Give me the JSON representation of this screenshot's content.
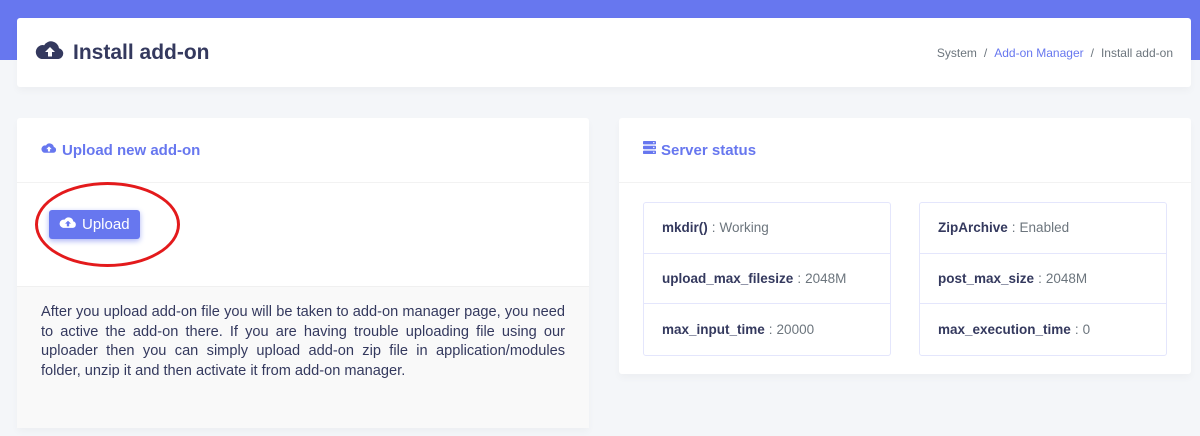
{
  "header": {
    "title": "Install add-on",
    "title_icon": "cloud-upload-icon"
  },
  "breadcrumb": {
    "items": [
      "System",
      "Add-on Manager",
      "Install add-on"
    ],
    "separator": "/"
  },
  "upload_card": {
    "title": "Upload new add-on",
    "title_icon": "cloud-upload-icon",
    "button_label": "Upload",
    "note": "After you upload add-on file you will be taken to add-on manager page, you need to active the add-on there. If you are having trouble uploading file using our uploader then you can simply upload add-on zip file in application/modules folder, unzip it and then activate it from add-on manager."
  },
  "server_card": {
    "title": "Server status",
    "title_icon": "server-icon",
    "left": [
      {
        "key": "mkdir()",
        "value": "Working"
      },
      {
        "key": "upload_max_filesize",
        "value": "2048M"
      },
      {
        "key": "max_input_time",
        "value": "20000"
      }
    ],
    "right": [
      {
        "key": "ZipArchive",
        "value": "Enabled"
      },
      {
        "key": "post_max_size",
        "value": "2048M"
      },
      {
        "key": "max_execution_time",
        "value": "0"
      }
    ]
  },
  "colors": {
    "primary": "#6777ef",
    "heading": "#34395e",
    "annotation": "#e31a1c"
  }
}
